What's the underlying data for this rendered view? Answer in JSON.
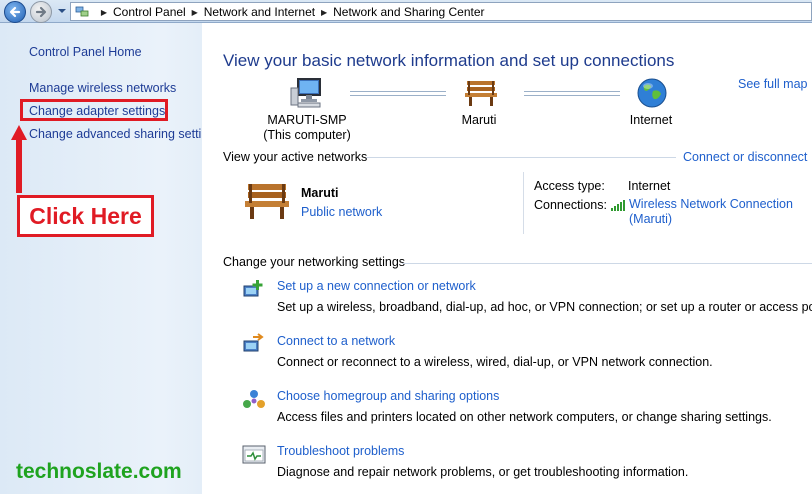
{
  "address_bar": {
    "breadcrumbs": [
      "Control Panel",
      "Network and Internet",
      "Network and Sharing Center"
    ]
  },
  "left_pane": {
    "home": "Control Panel Home",
    "links": [
      "Manage wireless networks",
      "Change adapter settings",
      "Change advanced sharing settings"
    ],
    "annotation": "Click Here",
    "watermark": "technoslate.com",
    "annotation_color": "#e01b24",
    "watermark_color": "#1fa31f"
  },
  "main": {
    "title": "View your basic network information and set up connections",
    "see_full_map": "See full map",
    "map": [
      {
        "name": "MARUTI-SMP",
        "sub": "(This computer)",
        "icon": "computer-icon"
      },
      {
        "name": "Maruti",
        "sub": "",
        "icon": "bench-icon"
      },
      {
        "name": "Internet",
        "sub": "",
        "icon": "globe-icon"
      }
    ],
    "active_networks": {
      "heading": "View your active networks",
      "connect_link": "Connect or disconnect",
      "network_name": "Maruti",
      "network_type": "Public network",
      "access_type_label": "Access type:",
      "access_type_value": "Internet",
      "connections_label": "Connections:",
      "connection_link": "Wireless Network Connection (Maruti)"
    },
    "settings": {
      "heading": "Change your networking settings",
      "tasks": [
        {
          "link": "Set up a new connection or network",
          "desc": "Set up a wireless, broadband, dial-up, ad hoc, or VPN connection; or set up a router or access point.",
          "icon": "new-connection-icon"
        },
        {
          "link": "Connect to a network",
          "desc": "Connect or reconnect to a wireless, wired, dial-up, or VPN network connection.",
          "icon": "connect-network-icon"
        },
        {
          "link": "Choose homegroup and sharing options",
          "desc": "Access files and printers located on other network computers, or change sharing settings.",
          "icon": "homegroup-icon"
        },
        {
          "link": "Troubleshoot problems",
          "desc": "Diagnose and repair network problems, or get troubleshooting information.",
          "icon": "troubleshoot-icon"
        }
      ]
    }
  }
}
